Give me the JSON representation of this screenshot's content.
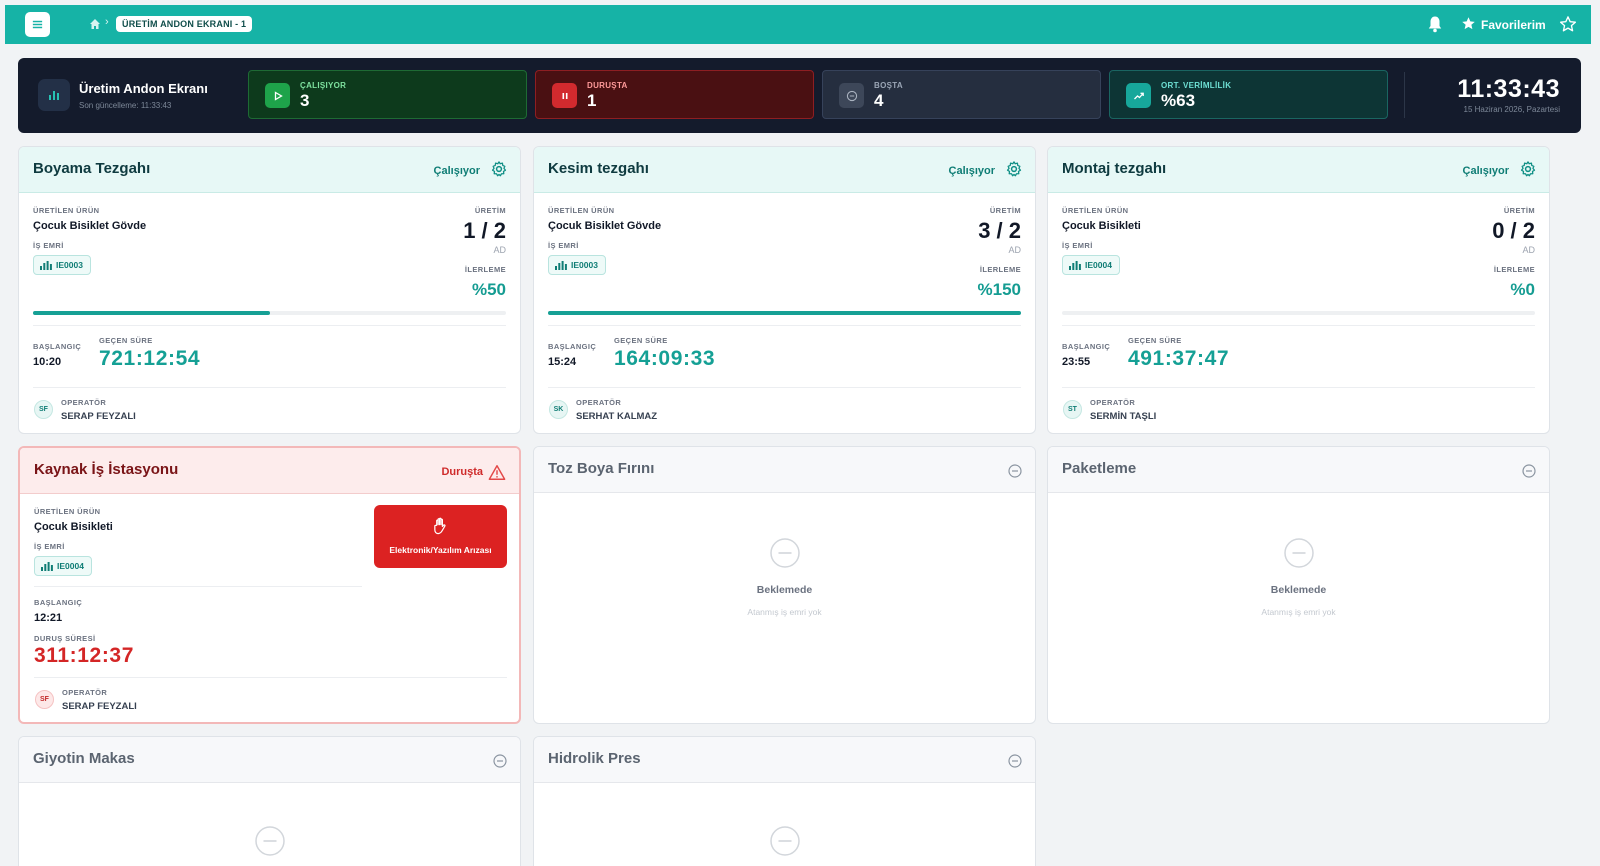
{
  "nav": {
    "breadcrumb": "ÜRETİM ANDON EKRANI - 1",
    "favorites_label": "Favorilerim"
  },
  "header": {
    "title": "Üretim Andon Ekranı",
    "last_update": "Son güncelleme: 11:33:43",
    "clock": "11:33:43",
    "date": "15 Haziran 2026, Pazartesi",
    "stats": {
      "running": {
        "label": "ÇALIŞIYOR",
        "value": "3",
        "color": "#1ea34a"
      },
      "down": {
        "label": "DURUŞTA",
        "value": "1",
        "color": "#d22a2e"
      },
      "idle": {
        "label": "BOŞTA",
        "value": "4",
        "color": "#3d4759"
      },
      "efficiency": {
        "label": "ORT. VERİMLİLİK",
        "value": "%63",
        "color": "#17a79b"
      }
    }
  },
  "labels": {
    "product": "ÜRETİLEN ÜRÜN",
    "work_order": "İŞ EMRİ",
    "production": "ÜRETİM",
    "unit": "AD",
    "progress": "İLERLEME",
    "start": "BAŞLANGIÇ",
    "elapsed": "GEÇEN SÜRE",
    "operator": "OPERATÖR",
    "downtime": "DURUŞ SÜRESİ",
    "waiting": "Beklemede",
    "no_work_order": "Atanmış iş emri yok"
  },
  "stations": [
    {
      "name": "Boyama Tezgahı",
      "status": "Çalışıyor",
      "product": "Çocuk Bisiklet Gövde",
      "work_order": "IE0003",
      "production": "1 / 2",
      "progress": "%50",
      "progress_fraction": 0.5,
      "start": "10:20",
      "elapsed": "721:12:54",
      "operator_initials": "SF",
      "operator": "SERAP FEYZALI"
    },
    {
      "name": "Kesim tezgahı",
      "status": "Çalışıyor",
      "product": "Çocuk Bisiklet Gövde",
      "work_order": "IE0003",
      "production": "3 / 2",
      "progress": "%150",
      "progress_fraction": 1.0,
      "start": "15:24",
      "elapsed": "164:09:33",
      "operator_initials": "SK",
      "operator": "SERHAT KALMAZ"
    },
    {
      "name": "Montaj tezgahı",
      "status": "Çalışıyor",
      "product": "Çocuk Bisikleti",
      "work_order": "IE0004",
      "production": "0 / 2",
      "progress": "%0",
      "progress_fraction": 0.0,
      "start": "23:55",
      "elapsed": "491:37:47",
      "operator_initials": "ST",
      "operator": "SERMİN TAŞLI"
    },
    {
      "name": "Kaynak İş İstasyonu",
      "status": "Duruşta",
      "product": "Çocuk Bisikleti",
      "work_order": "IE0004",
      "fault": "Elektronik/Yazılım Arızası",
      "start": "12:21",
      "downtime": "311:12:37",
      "operator_initials": "SF",
      "operator": "SERAP FEYZALI"
    },
    {
      "name": "Toz Boya Fırını"
    },
    {
      "name": "Paketleme"
    },
    {
      "name": "Giyotin Makas"
    },
    {
      "name": "Hidrolik Pres"
    }
  ]
}
